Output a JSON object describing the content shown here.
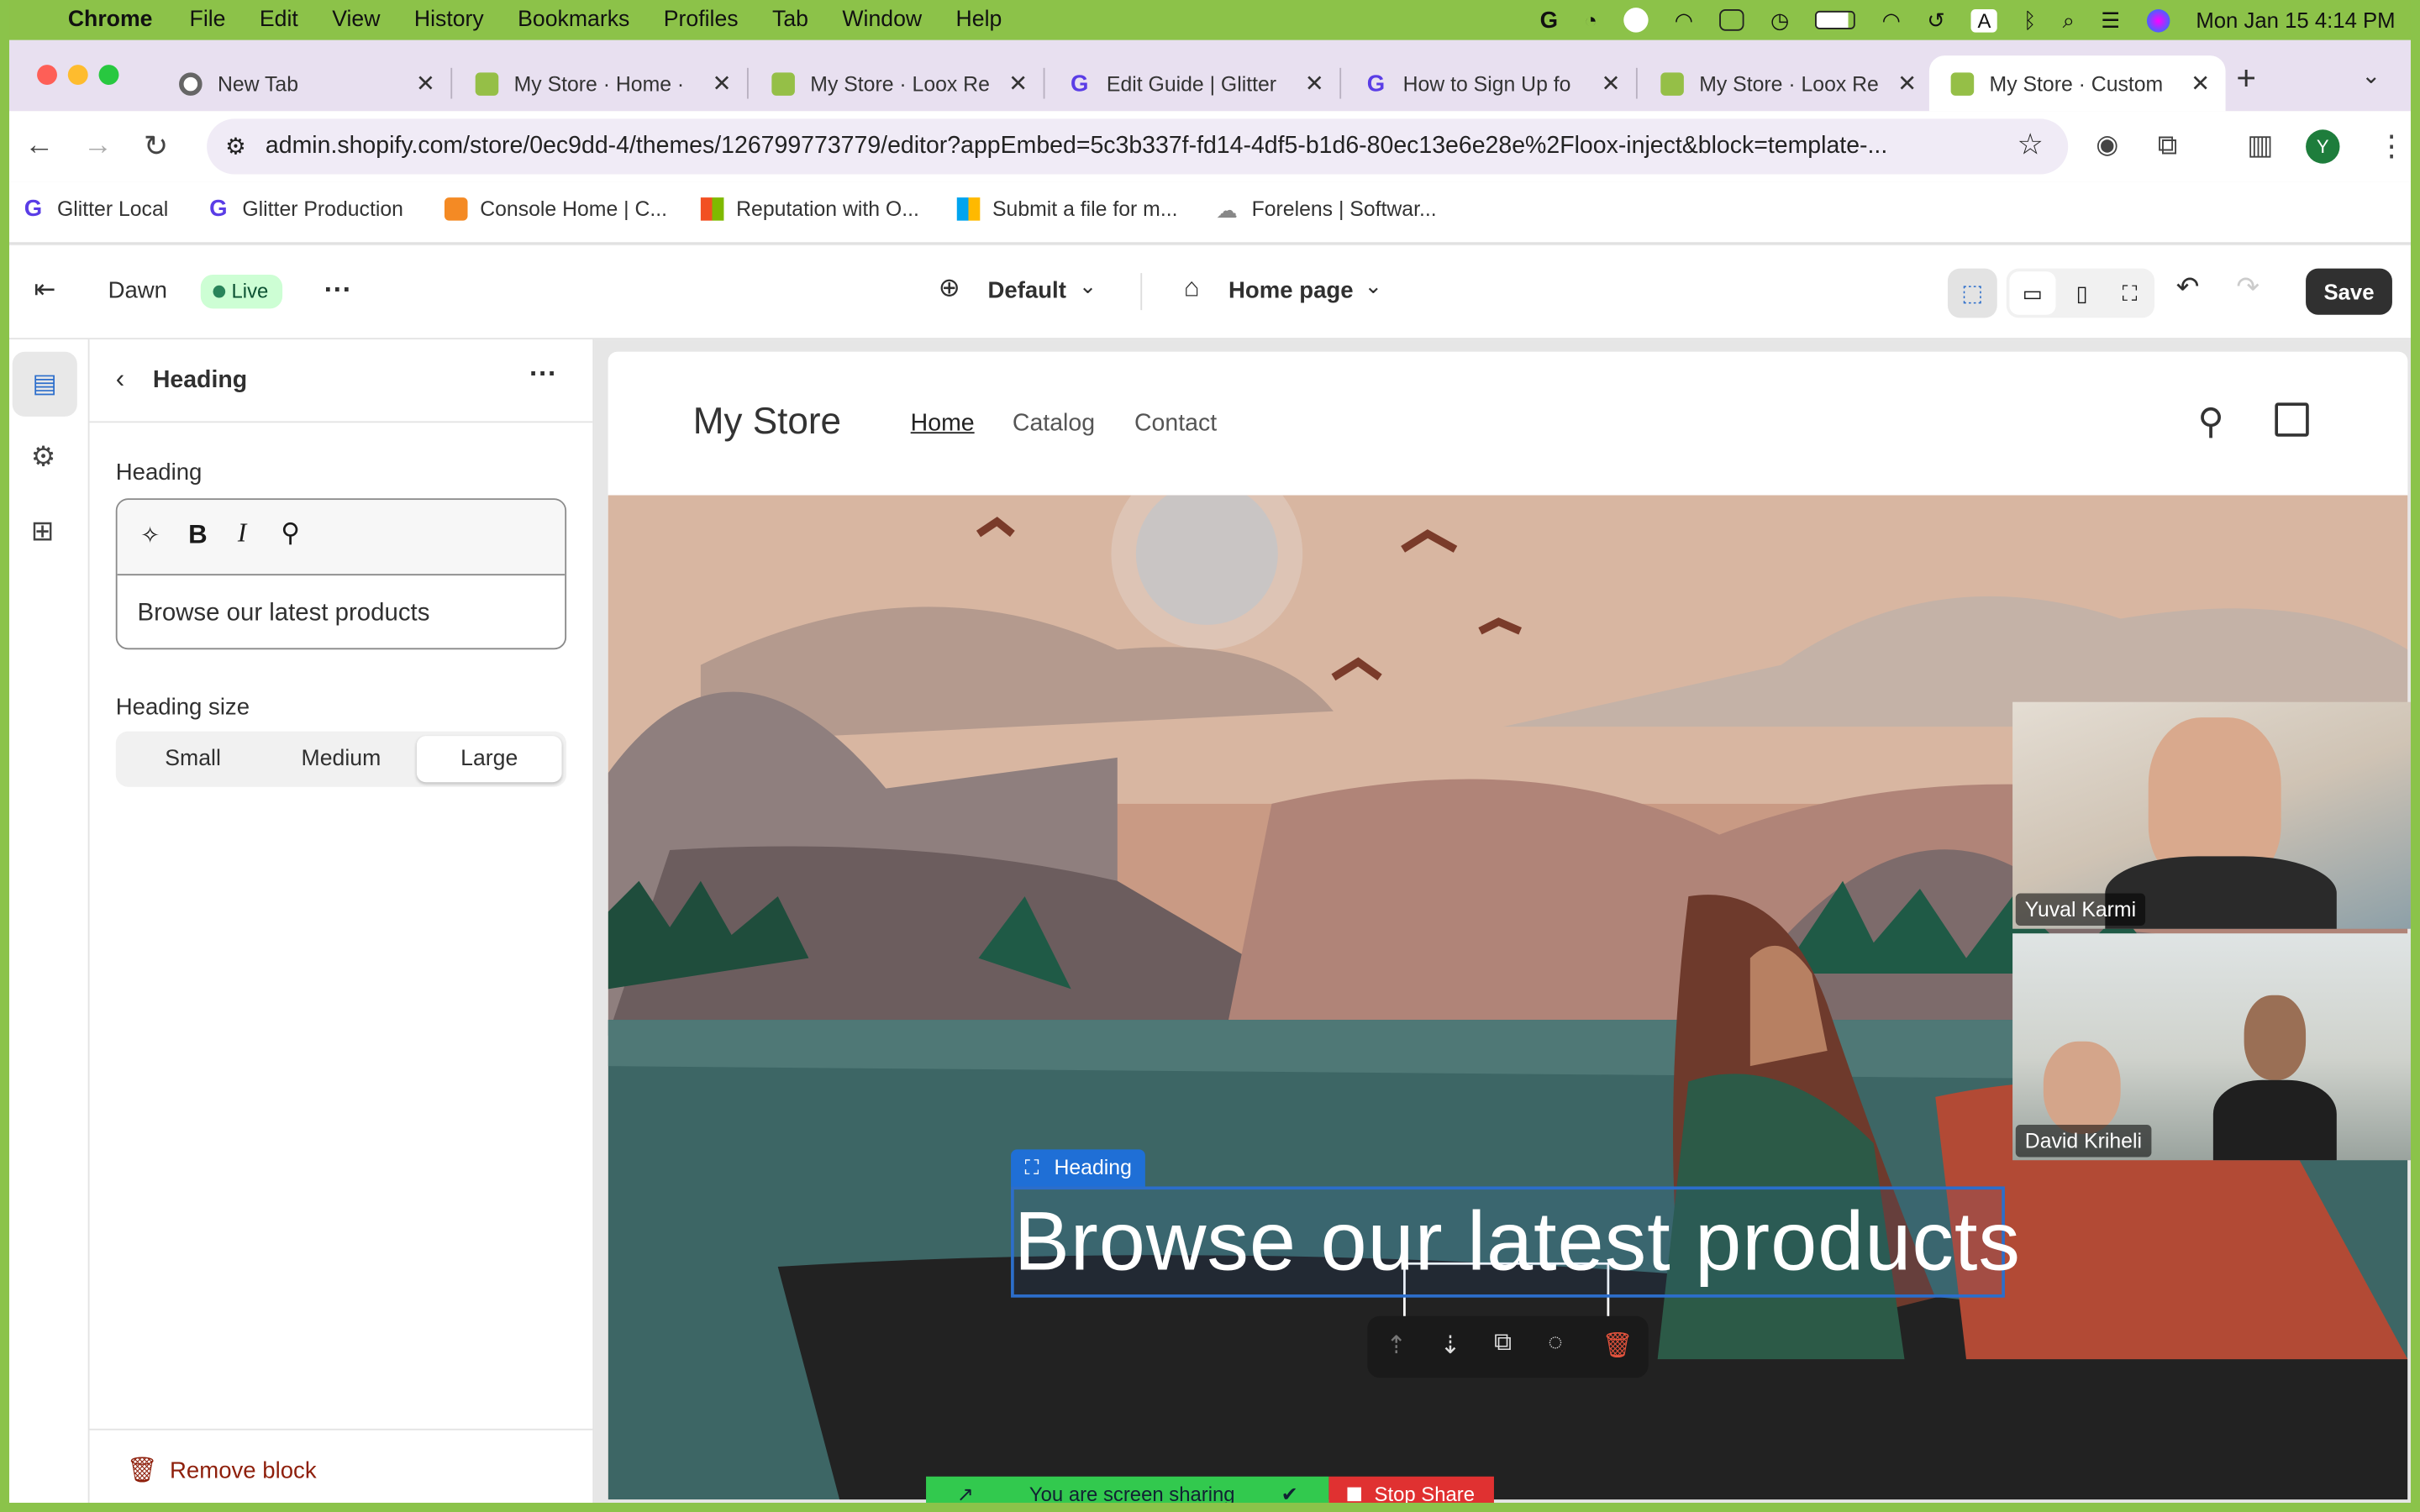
{
  "menubar": {
    "app": "Chrome",
    "items": [
      "File",
      "Edit",
      "View",
      "History",
      "Bookmarks",
      "Profiles",
      "Tab",
      "Window",
      "Help"
    ],
    "clock": "Mon Jan 15  4:14 PM",
    "keyboard_indicator": "A"
  },
  "tabs": [
    {
      "title": "New Tab",
      "icon": "chrome-icon"
    },
    {
      "title": "My Store · Home ·",
      "icon": "shopify-icon"
    },
    {
      "title": "My Store · Loox Re",
      "icon": "shopify-icon"
    },
    {
      "title": "Edit Guide | Glitter",
      "icon": "glitter-icon"
    },
    {
      "title": "How to Sign Up fo",
      "icon": "glitter-icon"
    },
    {
      "title": "My Store · Loox Re",
      "icon": "shopify-icon"
    },
    {
      "title": "My Store · Custom",
      "icon": "shopify-icon",
      "active": true
    }
  ],
  "address": {
    "url": "admin.shopify.com/store/0ec9dd-4/themes/126799773779/editor?appEmbed=5c3b337f-fd14-4df5-b1d6-80ec13e6e28e%2Floox-inject&block=template-..."
  },
  "profile_initial": "Y",
  "bookmarks": [
    {
      "label": "Glitter Local",
      "icon": "glitter-icon"
    },
    {
      "label": "Glitter Production",
      "icon": "glitter-icon"
    },
    {
      "label": "Console Home | C...",
      "icon": "aws-icon"
    },
    {
      "label": "Reputation with O...",
      "icon": "microsoft-icon"
    },
    {
      "label": "Submit a file for m...",
      "icon": "microsoft-icon"
    },
    {
      "label": "Forelens | Softwar...",
      "icon": "cloud-icon"
    }
  ],
  "editor": {
    "theme_name": "Dawn",
    "status": "Live",
    "more": "...",
    "locale": "Default",
    "template": "Home page",
    "save": "Save"
  },
  "panel": {
    "title": "Heading",
    "field_label": "Heading",
    "heading_value": "Browse our latest products",
    "size_label": "Heading size",
    "sizes": [
      "Small",
      "Medium",
      "Large"
    ],
    "selected_size": "Large",
    "remove": "Remove block"
  },
  "store": {
    "name": "My Store",
    "nav": [
      "Home",
      "Catalog",
      "Contact"
    ],
    "active_nav": "Home",
    "block_label": "Heading",
    "hero_heading": "Browse our latest products"
  },
  "call": {
    "participants": [
      "Yuval Karmi",
      "David Kriheli"
    ],
    "sharing_text": "You are screen sharing",
    "stop_label": "Stop Share"
  },
  "colors": {
    "frame": "#8bc34a",
    "shopify_green": "#95bf47",
    "glitter_purple": "#5a3de6",
    "save_bg": "#303030",
    "selection_blue": "#2c6ecb"
  }
}
